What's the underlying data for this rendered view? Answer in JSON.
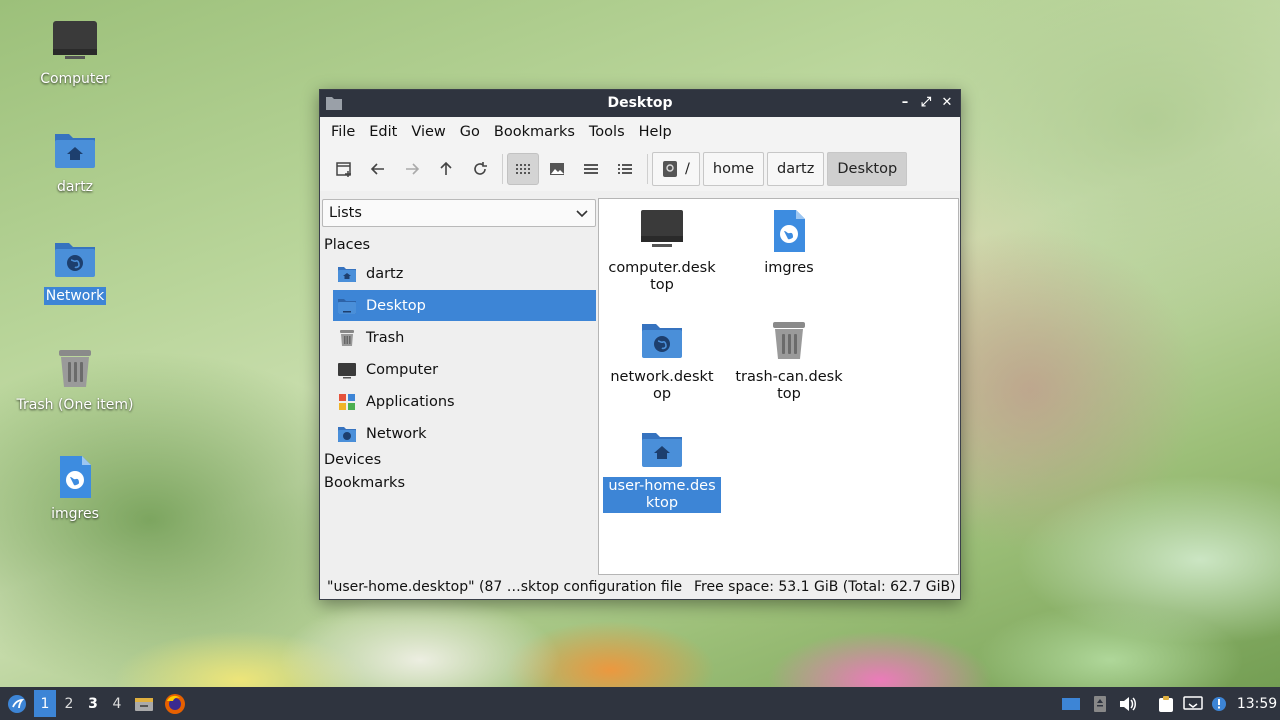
{
  "desktop": {
    "icons": [
      {
        "label": "Computer"
      },
      {
        "label": "dartz"
      },
      {
        "label": "Network"
      },
      {
        "label": "Trash (One item)"
      },
      {
        "label": "imgres"
      }
    ]
  },
  "window": {
    "title": "Desktop",
    "controls": {
      "minimize": "–",
      "maximize": "⤢",
      "close": "✕"
    },
    "menu": [
      "File",
      "Edit",
      "View",
      "Go",
      "Bookmarks",
      "Tools",
      "Help"
    ],
    "path": [
      "/",
      "home",
      "dartz",
      "Desktop"
    ],
    "sidebar": {
      "mode": "Lists",
      "sections": [
        "Places",
        "Devices",
        "Bookmarks"
      ],
      "places": [
        "dartz",
        "Desktop",
        "Trash",
        "Computer",
        "Applications",
        "Network"
      ]
    },
    "files": [
      {
        "name": "computer.desktop"
      },
      {
        "name": "imgres"
      },
      {
        "name": "network.desktop"
      },
      {
        "name": "trash-can.desktop"
      },
      {
        "name": "user-home.desktop"
      }
    ],
    "status": {
      "selection": "\"user-home.desktop\" (87 …sktop configuration file",
      "free_space": "Free space: 53.1 GiB (Total: 62.7 GiB)"
    }
  },
  "taskbar": {
    "workspaces": [
      "1",
      "2",
      "3",
      "4"
    ],
    "clock": "13:59"
  },
  "colors": {
    "accent": "#3d85d6",
    "folder": "#4a8fd9",
    "titlebar": "#2f343f"
  }
}
